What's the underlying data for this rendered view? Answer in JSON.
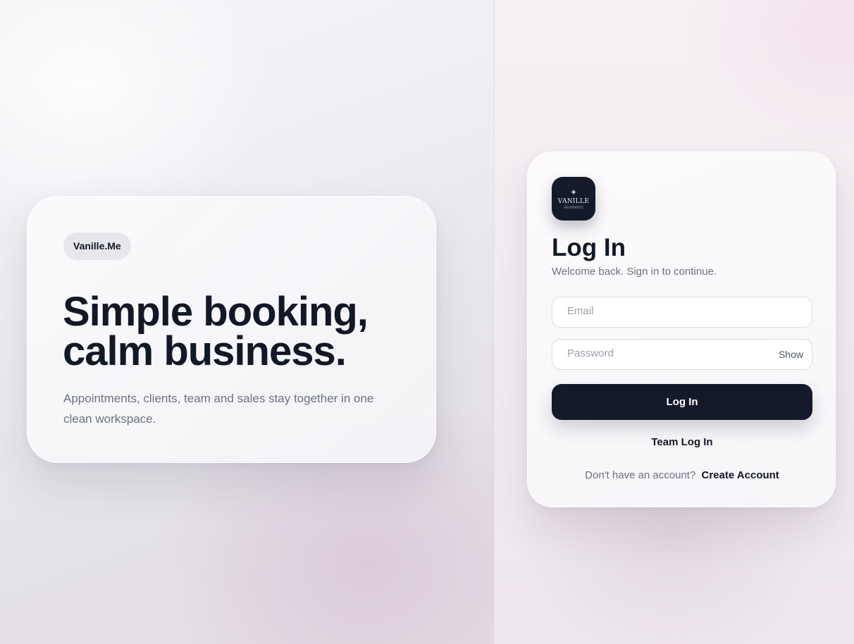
{
  "brand": {
    "name": "Vanille.Me",
    "logo_text": "VANILLE",
    "logo_script": "Aesthetics"
  },
  "hero": {
    "title_line1": "Simple booking,",
    "title_line2": "calm business.",
    "subtitle": "Appointments, clients, team and sales stay together in one clean workspace."
  },
  "login": {
    "title": "Log In",
    "subtitle": "Welcome back. Sign in to continue.",
    "email_placeholder": "Email",
    "password_placeholder": "Password",
    "show_label": "Show",
    "submit_label": "Log In",
    "team_login_label": "Team Log In",
    "signup_prompt": "Don't have an account?",
    "signup_link": "Create Account"
  },
  "colors": {
    "primary_dark": "#141a2a",
    "text_muted": "#6b7280"
  },
  "icons": {
    "logo": "vanille-logo-icon"
  }
}
